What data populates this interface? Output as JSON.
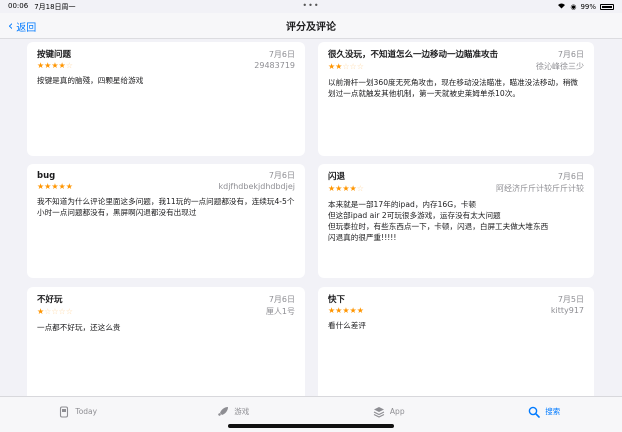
{
  "status": {
    "time": "00:06",
    "date": "7月18日周一",
    "battery": "99%"
  },
  "nav": {
    "back_label": "返回",
    "title": "评分及评论"
  },
  "reviews": [
    {
      "title": "按键问题",
      "date": "7月6日",
      "author": "29483719",
      "rating": 4,
      "body": "按键是真的脑殘，四颗星给游戏"
    },
    {
      "title": "很久没玩，不知道怎么一边移动一边瞄准攻击",
      "date": "7月6日",
      "author": "徐沁峰徐三少",
      "rating": 2,
      "body": "以前滑杆一划360度无死角攻击，现在移动没法瞄准，瞄准没法移动，稍微划过一点就触发其他机制，第一天就被史莱姆单杀10次。"
    },
    {
      "title": "bug",
      "date": "7月6日",
      "author": "kdjfhdbekjdhdbdjej",
      "rating": 5,
      "body": "我不知道为什么评论里面这多问题，我11玩的一点问题都没有，连续玩4-5个小时一点问题都没有，黑屏啊闪退都没有出现过"
    },
    {
      "title": "闪退",
      "date": "7月6日",
      "author": "阿经济斤斤计较斤斤计较",
      "rating": 4,
      "body": "本来就是一部17年的ipad，内存16G，卡顿\n但这部ipad air 2可玩很多游戏，运存没有太大问题\n但玩泰拉时，有些东西点一下，卡顿，闪退，白屏工夫做大堆东西\n闪退真的很严重!!!!!"
    },
    {
      "title": "不好玩",
      "date": "7月6日",
      "author": "厘人1号",
      "rating": 1,
      "body": "一点都不好玩，还这么贵"
    },
    {
      "title": "快下",
      "date": "7月5日",
      "author": "kitty917",
      "rating": 5,
      "body": "看什么差评"
    }
  ],
  "tabs": [
    {
      "label": "Today",
      "icon": "today-icon",
      "active": false
    },
    {
      "label": "游戏",
      "icon": "rocket-icon",
      "active": false
    },
    {
      "label": "App",
      "icon": "app-stack-icon",
      "active": false
    },
    {
      "label": "搜索",
      "icon": "search-icon",
      "active": true
    }
  ]
}
